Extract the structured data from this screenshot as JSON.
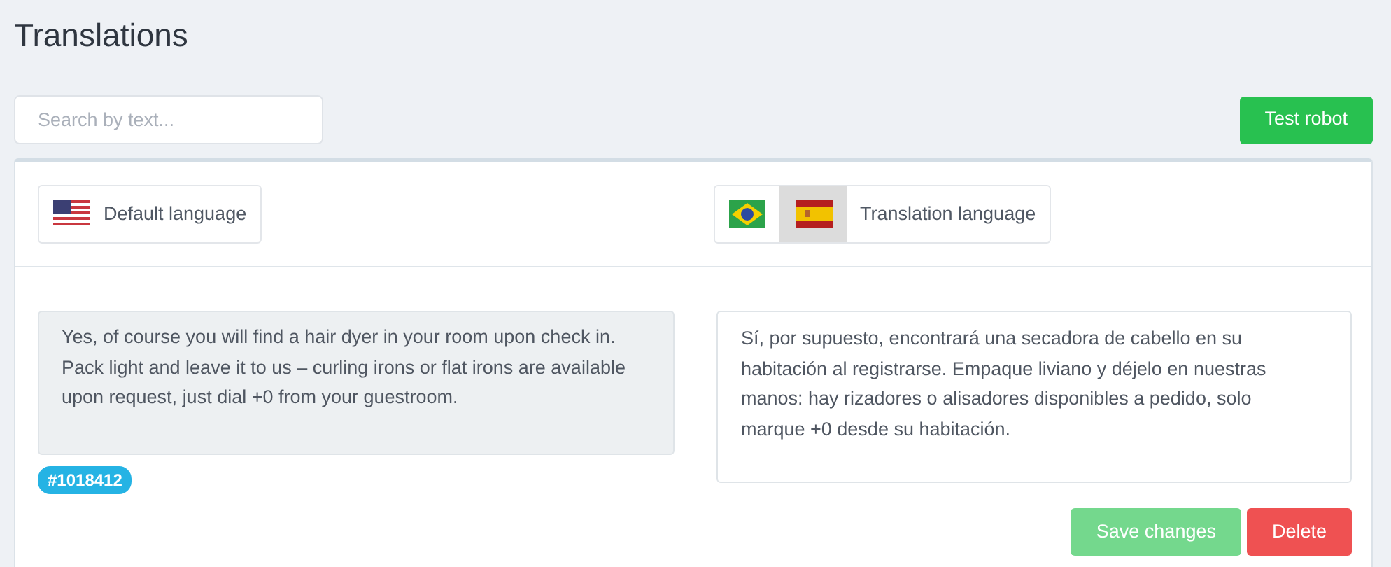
{
  "title": "Translations",
  "search": {
    "placeholder": "Search by text..."
  },
  "test_button": "Test robot",
  "default_language": {
    "label": "Default language",
    "flag": {
      "kind": "us"
    }
  },
  "translation_language": {
    "label": "Translation language",
    "flags": [
      {
        "kind": "br",
        "selected": false
      },
      {
        "kind": "es",
        "selected": true
      }
    ]
  },
  "source_text": "Yes, of course you will find a hair dyer in your room upon check in. Pack light and leave it to us – curling irons or flat irons are available upon request, just dial +0 from your guestroom.",
  "id_badge": "#1018412",
  "translation_text": "Sí, por supuesto, encontrará una secadora de cabello en su habitación al registrarse. Empaque liviano y déjelo en nuestras manos: hay rizadores o alisadores disponibles a pedido, solo marque +0 desde su habitación.",
  "buttons": [
    {
      "kind": "save",
      "label": "Save changes",
      "disabled": true
    },
    {
      "kind": "delete",
      "label": "Delete",
      "disabled": false
    }
  ]
}
